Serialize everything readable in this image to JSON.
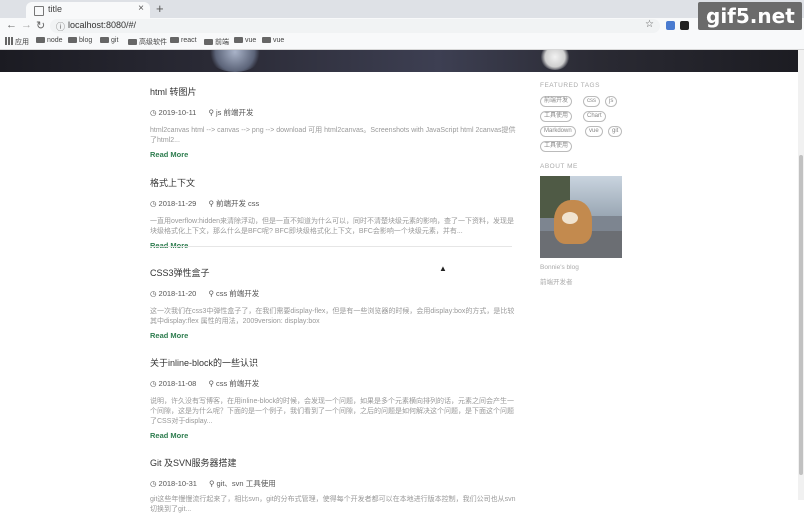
{
  "browser": {
    "tab_title": "title",
    "tab_close": "×",
    "new_tab": "+",
    "url": "localhost:8080/#/",
    "bookmarks": [
      "应用",
      "node",
      "blog",
      "git",
      "高级软件",
      "react",
      "前端",
      "vue",
      "vue"
    ],
    "watermark": "gif5.net"
  },
  "posts": [
    {
      "title": "html 转图片",
      "date": "2019-10-11",
      "category": "js",
      "tag": "前端开发",
      "excerpt": "html2canvas html --> canvas --> png --> download 可用 html2canvas。Screenshots with JavaScript html 2canvas提供了html2...",
      "more": "Read More"
    },
    {
      "title": "格式上下文",
      "date": "2018-11-29",
      "category": "前端开发",
      "tag": "css",
      "excerpt": "一直用overflow:hidden来清除浮动，但是一直不知道为什么可以，同时不清楚块级元素的影响，查了一下资料，发现是块级格式化上下文，那么什么是BFC呢? BFC即块级格式化上下文，BFC会影响一个块级元素，并有...",
      "more": "Read More"
    },
    {
      "title": "CSS3弹性盒子",
      "date": "2018-11-20",
      "category": "css",
      "tag": "前端开发",
      "excerpt": "这一次我们在css3中弹性盒子了，在我们需要display-flex，但是有一些浏览器的时候，会用display:box的方式，是比较其中display:flex 属性的用法，2009version: display:box",
      "more": "Read More"
    },
    {
      "title": "关于inline-block的一些认识",
      "date": "2018-11-08",
      "category": "css",
      "tag": "前端开发",
      "excerpt": "说明，许久没有写博客，在用inline-block的时候，会发现一个问题，如果是多个元素横向排列的话，元素之间会产生一个间隙，这是为什么呢？下面的是一个例子，我们看到了一个间隙，之后的问题是如何解决这个问题，是下面这个问题了CSS对于display...",
      "more": "Read More"
    },
    {
      "title": "Git 及SVN服务器搭建",
      "date": "2018-10-31",
      "category": "git、svn",
      "tag": "工具使用",
      "excerpt": "git这些年慢慢流行起来了，相比svn，git的分布式管理，使得每个开发者都可以在本地进行版本控制，我们公司也从svn切换到了git...",
      "more": "Read More"
    }
  ],
  "sidebar": {
    "tags_heading": "FEATURED TAGS",
    "tags": [
      "前端开发",
      "css",
      "js",
      "工具使用",
      "Chart",
      "Markdown",
      "vue",
      "git",
      "工具使用"
    ],
    "about_heading": "ABOUT ME",
    "blog_name": "Bonnie's blog",
    "blog_desc": "前端开发者"
  }
}
